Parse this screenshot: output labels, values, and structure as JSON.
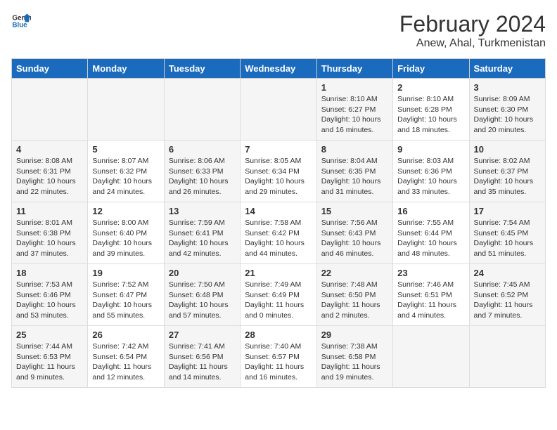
{
  "header": {
    "logo_general": "General",
    "logo_blue": "Blue",
    "month_title": "February 2024",
    "location": "Anew, Ahal, Turkmenistan"
  },
  "days_of_week": [
    "Sunday",
    "Monday",
    "Tuesday",
    "Wednesday",
    "Thursday",
    "Friday",
    "Saturday"
  ],
  "weeks": [
    [
      {
        "day": "",
        "info": ""
      },
      {
        "day": "",
        "info": ""
      },
      {
        "day": "",
        "info": ""
      },
      {
        "day": "",
        "info": ""
      },
      {
        "day": "1",
        "info": "Sunrise: 8:10 AM\nSunset: 6:27 PM\nDaylight: 10 hours\nand 16 minutes."
      },
      {
        "day": "2",
        "info": "Sunrise: 8:10 AM\nSunset: 6:28 PM\nDaylight: 10 hours\nand 18 minutes."
      },
      {
        "day": "3",
        "info": "Sunrise: 8:09 AM\nSunset: 6:30 PM\nDaylight: 10 hours\nand 20 minutes."
      }
    ],
    [
      {
        "day": "4",
        "info": "Sunrise: 8:08 AM\nSunset: 6:31 PM\nDaylight: 10 hours\nand 22 minutes."
      },
      {
        "day": "5",
        "info": "Sunrise: 8:07 AM\nSunset: 6:32 PM\nDaylight: 10 hours\nand 24 minutes."
      },
      {
        "day": "6",
        "info": "Sunrise: 8:06 AM\nSunset: 6:33 PM\nDaylight: 10 hours\nand 26 minutes."
      },
      {
        "day": "7",
        "info": "Sunrise: 8:05 AM\nSunset: 6:34 PM\nDaylight: 10 hours\nand 29 minutes."
      },
      {
        "day": "8",
        "info": "Sunrise: 8:04 AM\nSunset: 6:35 PM\nDaylight: 10 hours\nand 31 minutes."
      },
      {
        "day": "9",
        "info": "Sunrise: 8:03 AM\nSunset: 6:36 PM\nDaylight: 10 hours\nand 33 minutes."
      },
      {
        "day": "10",
        "info": "Sunrise: 8:02 AM\nSunset: 6:37 PM\nDaylight: 10 hours\nand 35 minutes."
      }
    ],
    [
      {
        "day": "11",
        "info": "Sunrise: 8:01 AM\nSunset: 6:38 PM\nDaylight: 10 hours\nand 37 minutes."
      },
      {
        "day": "12",
        "info": "Sunrise: 8:00 AM\nSunset: 6:40 PM\nDaylight: 10 hours\nand 39 minutes."
      },
      {
        "day": "13",
        "info": "Sunrise: 7:59 AM\nSunset: 6:41 PM\nDaylight: 10 hours\nand 42 minutes."
      },
      {
        "day": "14",
        "info": "Sunrise: 7:58 AM\nSunset: 6:42 PM\nDaylight: 10 hours\nand 44 minutes."
      },
      {
        "day": "15",
        "info": "Sunrise: 7:56 AM\nSunset: 6:43 PM\nDaylight: 10 hours\nand 46 minutes."
      },
      {
        "day": "16",
        "info": "Sunrise: 7:55 AM\nSunset: 6:44 PM\nDaylight: 10 hours\nand 48 minutes."
      },
      {
        "day": "17",
        "info": "Sunrise: 7:54 AM\nSunset: 6:45 PM\nDaylight: 10 hours\nand 51 minutes."
      }
    ],
    [
      {
        "day": "18",
        "info": "Sunrise: 7:53 AM\nSunset: 6:46 PM\nDaylight: 10 hours\nand 53 minutes."
      },
      {
        "day": "19",
        "info": "Sunrise: 7:52 AM\nSunset: 6:47 PM\nDaylight: 10 hours\nand 55 minutes."
      },
      {
        "day": "20",
        "info": "Sunrise: 7:50 AM\nSunset: 6:48 PM\nDaylight: 10 hours\nand 57 minutes."
      },
      {
        "day": "21",
        "info": "Sunrise: 7:49 AM\nSunset: 6:49 PM\nDaylight: 11 hours\nand 0 minutes."
      },
      {
        "day": "22",
        "info": "Sunrise: 7:48 AM\nSunset: 6:50 PM\nDaylight: 11 hours\nand 2 minutes."
      },
      {
        "day": "23",
        "info": "Sunrise: 7:46 AM\nSunset: 6:51 PM\nDaylight: 11 hours\nand 4 minutes."
      },
      {
        "day": "24",
        "info": "Sunrise: 7:45 AM\nSunset: 6:52 PM\nDaylight: 11 hours\nand 7 minutes."
      }
    ],
    [
      {
        "day": "25",
        "info": "Sunrise: 7:44 AM\nSunset: 6:53 PM\nDaylight: 11 hours\nand 9 minutes."
      },
      {
        "day": "26",
        "info": "Sunrise: 7:42 AM\nSunset: 6:54 PM\nDaylight: 11 hours\nand 12 minutes."
      },
      {
        "day": "27",
        "info": "Sunrise: 7:41 AM\nSunset: 6:56 PM\nDaylight: 11 hours\nand 14 minutes."
      },
      {
        "day": "28",
        "info": "Sunrise: 7:40 AM\nSunset: 6:57 PM\nDaylight: 11 hours\nand 16 minutes."
      },
      {
        "day": "29",
        "info": "Sunrise: 7:38 AM\nSunset: 6:58 PM\nDaylight: 11 hours\nand 19 minutes."
      },
      {
        "day": "",
        "info": ""
      },
      {
        "day": "",
        "info": ""
      }
    ]
  ]
}
